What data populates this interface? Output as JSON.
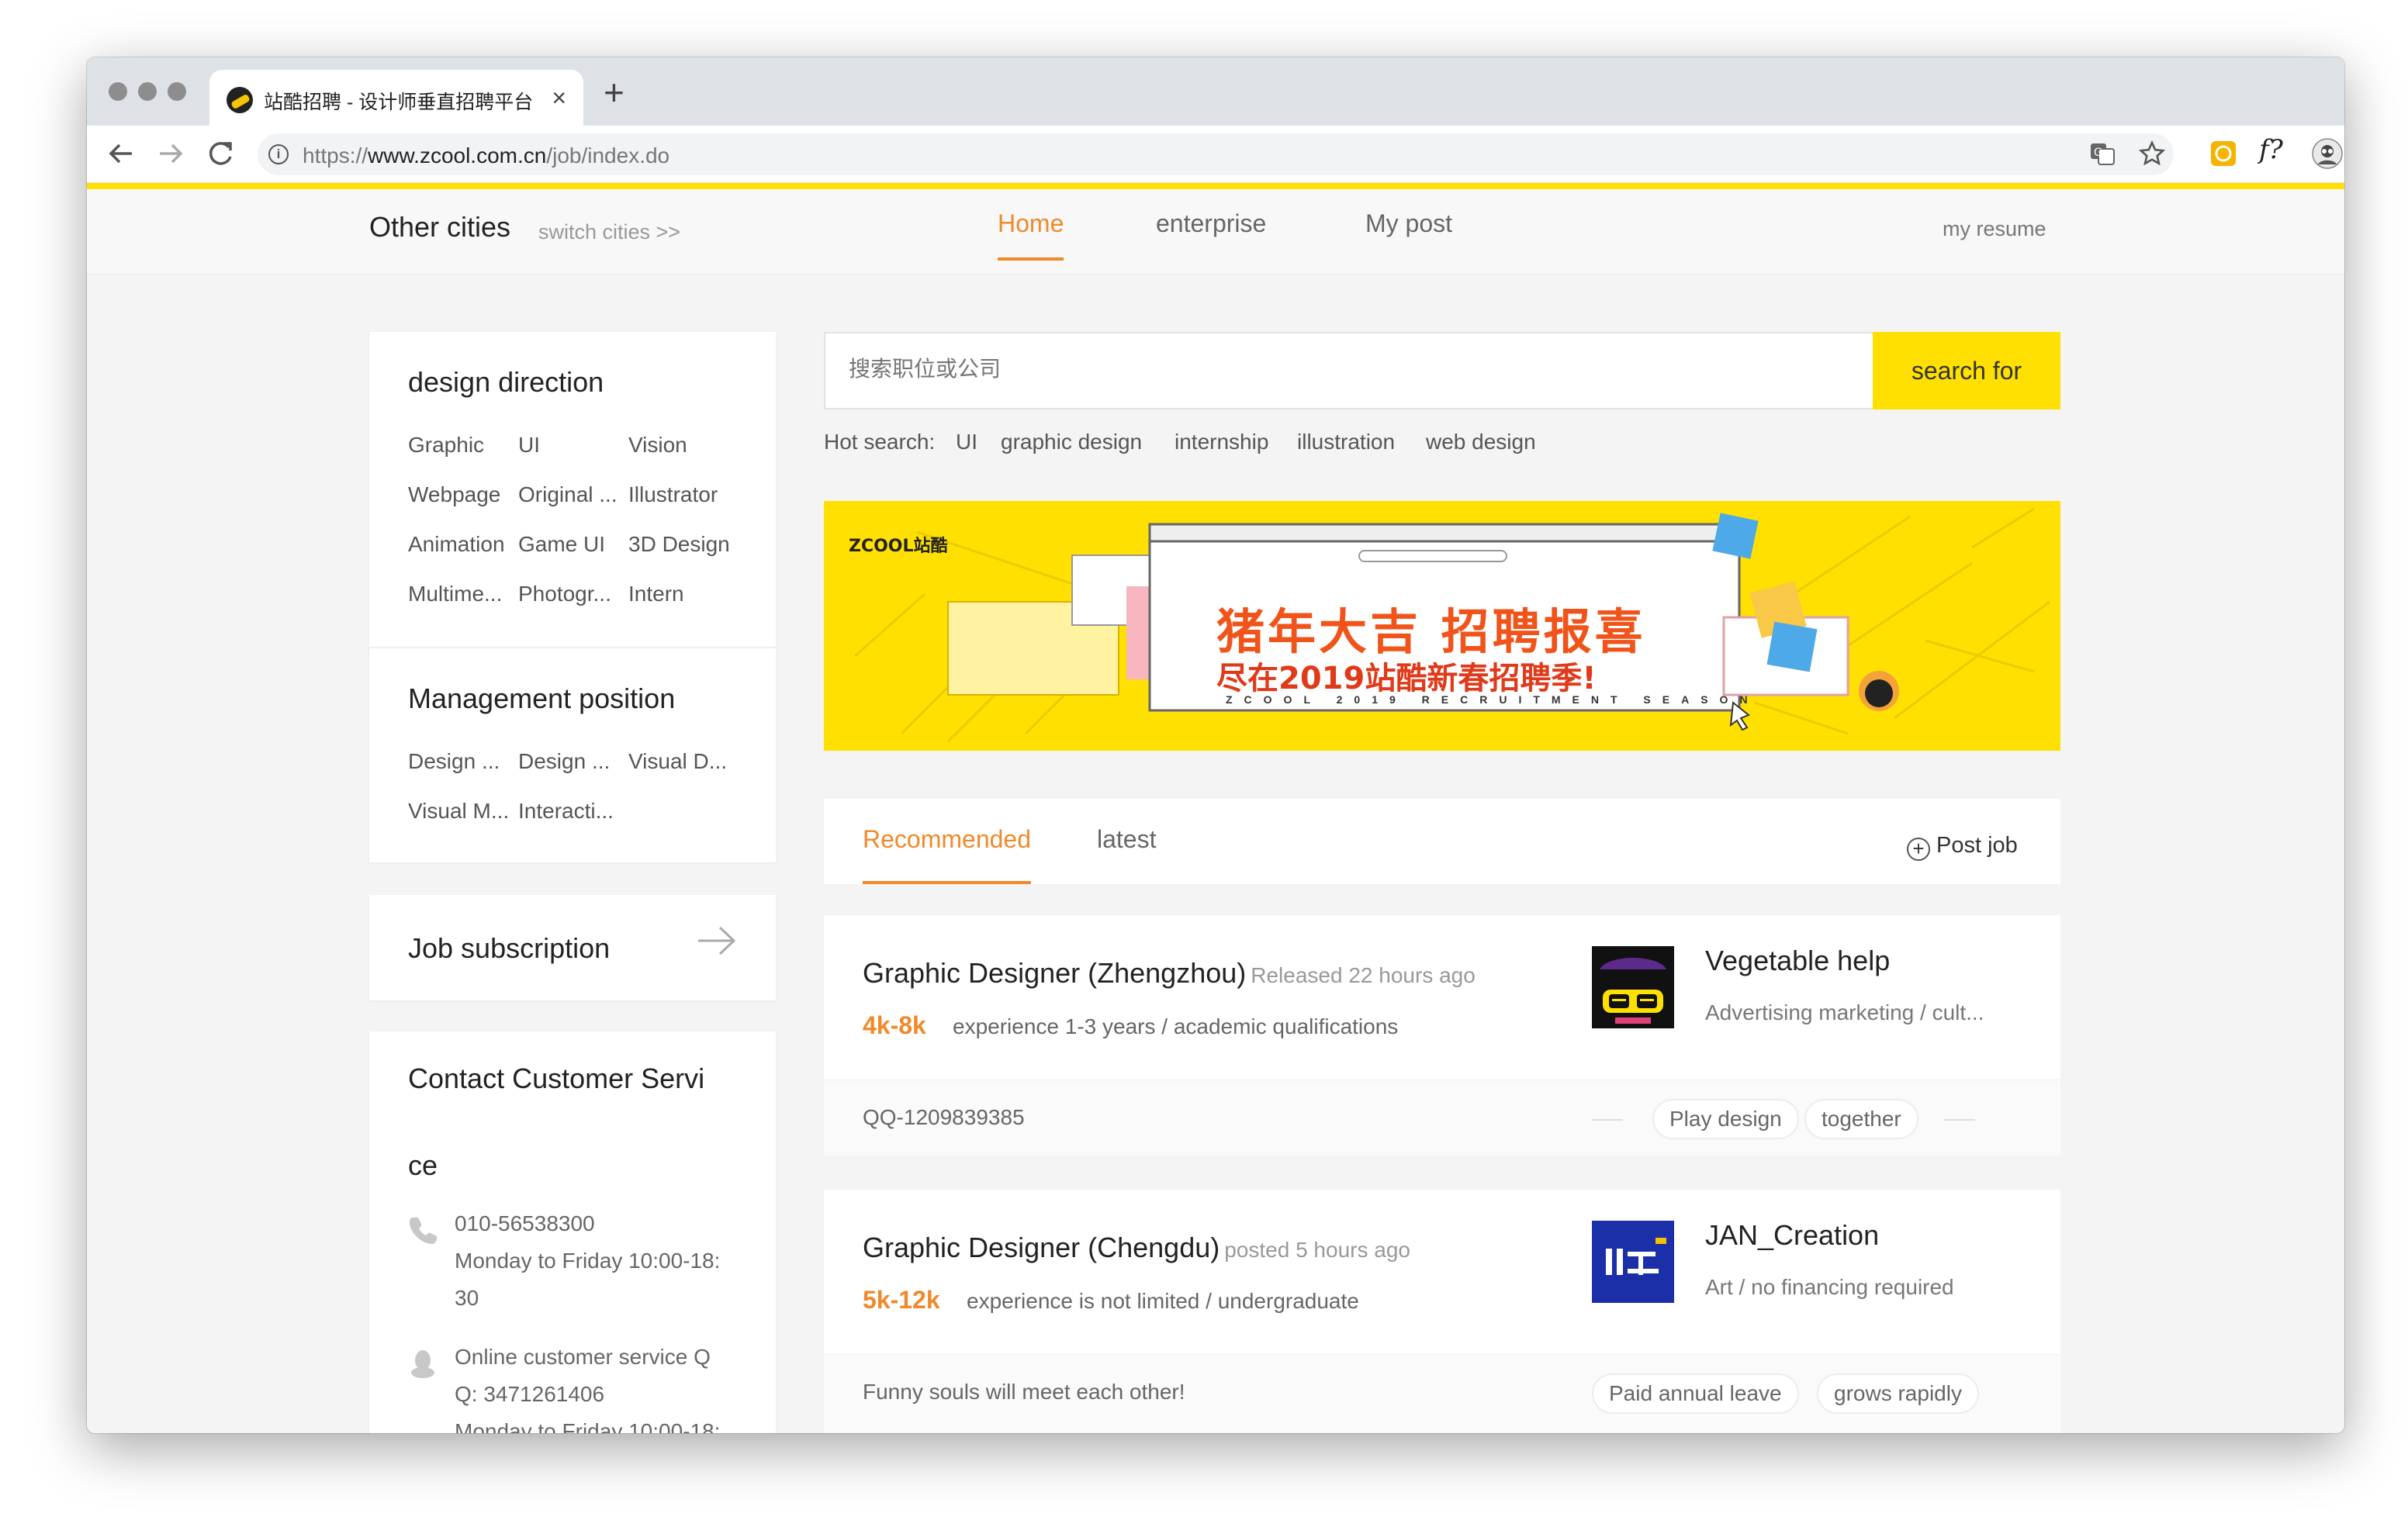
{
  "browser": {
    "tab_title": "站酷招聘 - 设计师垂直招聘平台",
    "url_scheme": "https://",
    "url_host": "www.zcool.com.cn",
    "url_path": "/job/index.do",
    "icons": [
      "back-arrow-icon",
      "forward-arrow-icon",
      "reload-icon",
      "info-icon",
      "translate-icon",
      "star-icon",
      "extension-icon",
      "function-icon",
      "profile-avatar-icon",
      "menu-dots-icon"
    ],
    "new_tab": "+",
    "close": "×",
    "fx": "f?"
  },
  "header": {
    "city": "Other cities",
    "switch": "switch cities >>",
    "nav": [
      "Home",
      "enterprise",
      "My post"
    ],
    "resume": "my resume",
    "accent_color": "#f0892a",
    "brand_yellow": "#ffe000"
  },
  "sidebar": {
    "design_title": "design direction",
    "design_items": [
      "Graphic",
      "UI",
      "Vision",
      "Webpage",
      "Original ...",
      "Illustrator",
      "Animation",
      "Game UI",
      "3D Design",
      "Multime...",
      "Photogr...",
      "Intern"
    ],
    "management_title": "Management position",
    "management_items": [
      "Design ...",
      "Design ...",
      "Visual D...",
      "Visual M...",
      "Interacti..."
    ],
    "subscription": "Job subscription",
    "contact_title_1": "Contact Customer Servi",
    "contact_title_2": "ce",
    "phone": "010-56538300",
    "phone_hours_1": "Monday to Friday 10:00-18:",
    "phone_hours_2": "30",
    "qq_1": "Online customer service Q",
    "qq_2": "Q: 3471261406",
    "qq_hours": "Monday to Friday 10:00-18:"
  },
  "search": {
    "placeholder": "搜索职位或公司",
    "button": "search for",
    "hot_label": "Hot search:",
    "hot_items": [
      "UI",
      "graphic design",
      "internship",
      "illustration",
      "web design"
    ]
  },
  "banner": {
    "logo": "ZCOOL站酷",
    "headline": "猪年大吉 招聘报喜",
    "subheadline": "尽在2019站酷新春招聘季!",
    "tagline": "ZCOOL 2019 RECRUITMENT SEASON"
  },
  "tabs": {
    "items": [
      "Recommended",
      "latest"
    ],
    "post_job": "Post job"
  },
  "jobs": [
    {
      "title": "Graphic Designer (Zhengzhou)",
      "time": "Released 22 hours ago",
      "salary": "4k-8k",
      "requirements": "experience 1-3 years / academic qualifications",
      "company": "Vegetable help",
      "company_desc": "Advertising marketing / cult...",
      "footer": "QQ-1209839385",
      "tags": [
        "Play design",
        "together"
      ]
    },
    {
      "title": "Graphic Designer (Chengdu)",
      "time": "posted 5 hours ago",
      "salary": "5k-12k",
      "requirements": "experience is not limited / undergraduate",
      "company": "JAN_Creation",
      "company_desc": "Art / no financing required",
      "footer": "Funny souls will meet each other!",
      "tags": [
        "Paid annual leave",
        "grows rapidly"
      ]
    }
  ]
}
